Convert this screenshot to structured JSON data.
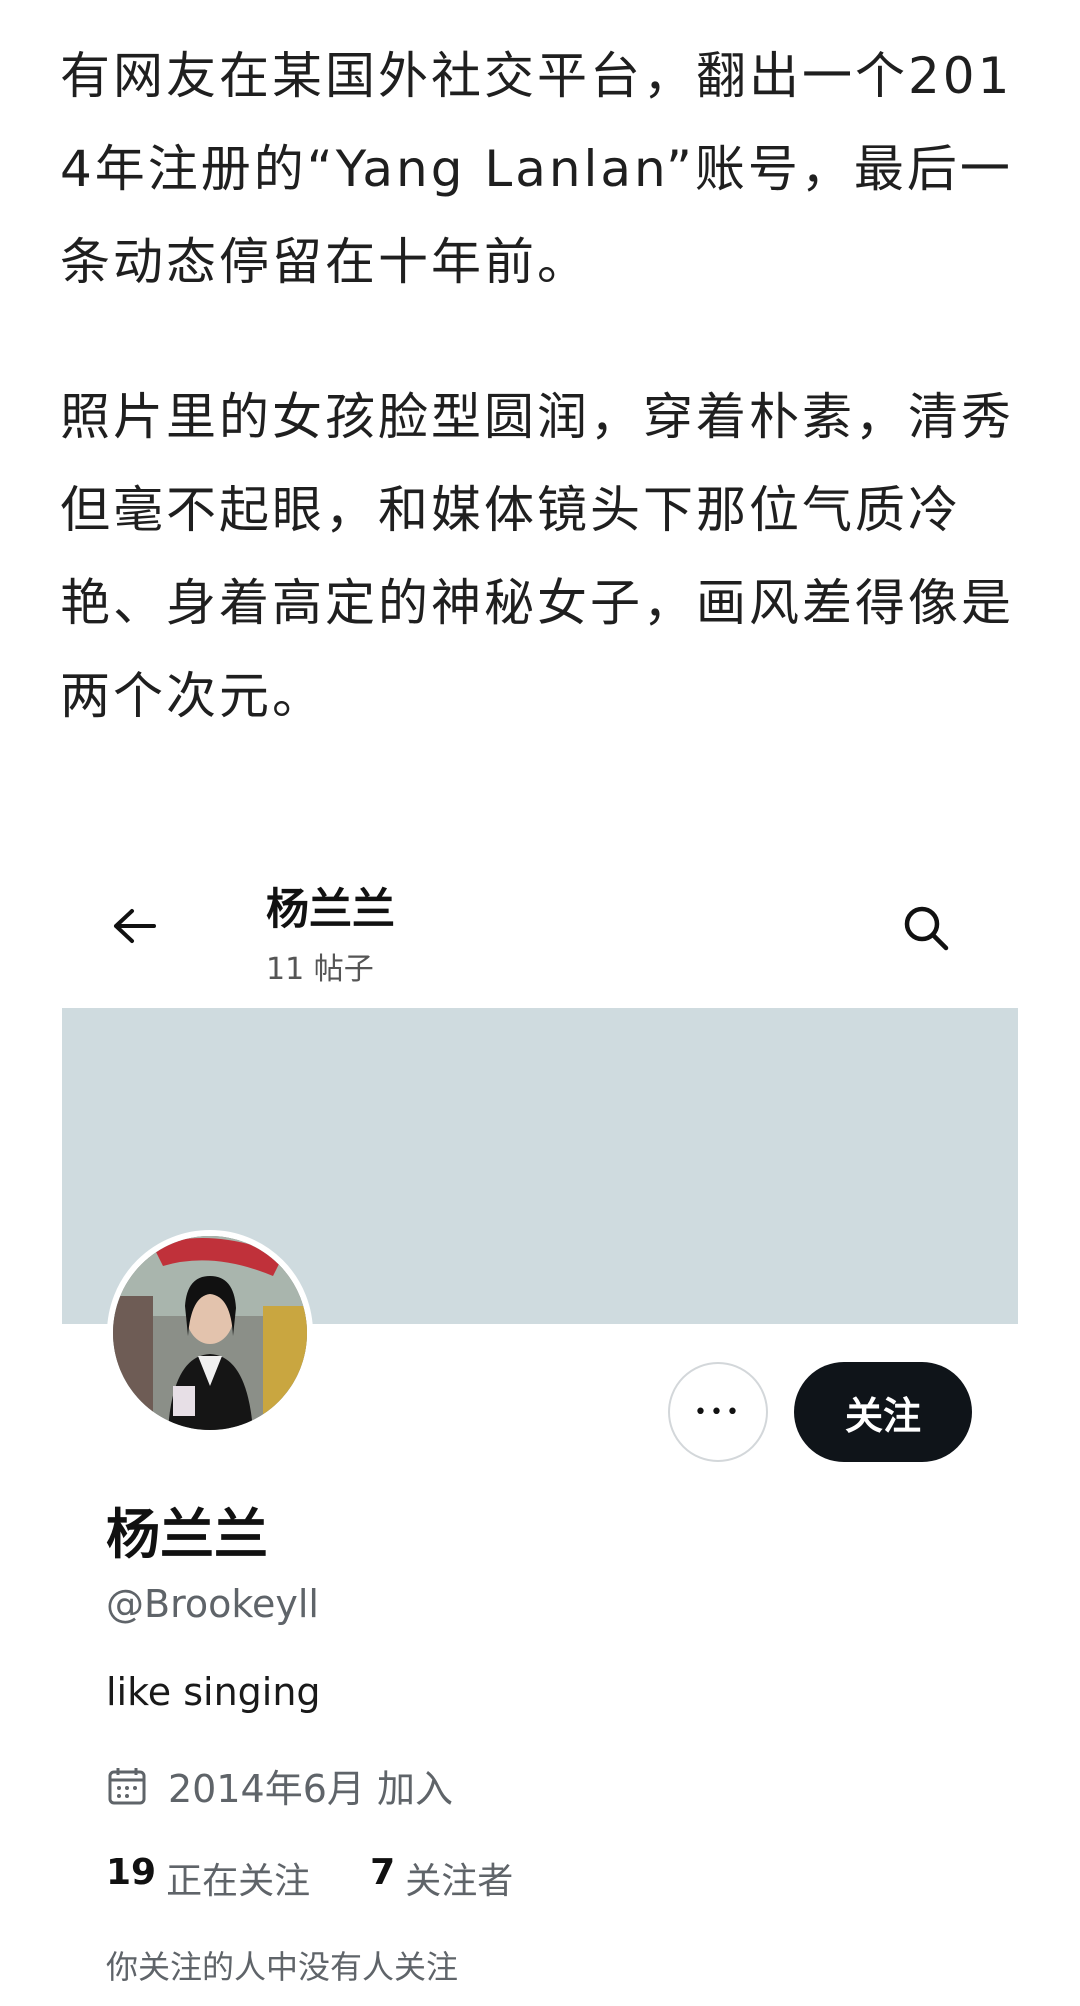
{
  "article": {
    "paragraphs": [
      "有网友在某国外社交平台，翻出一个2014年注册的“Yang Lanlan”账号，最后一条动态停留在十年前。",
      "照片里的女孩脸型圆润，穿着朴素，清秀但毫不起眼，和媒体镜头下那位气质冷艳、身着高定的神秘女子，画风差得像是两个次元。"
    ]
  },
  "profile": {
    "topbar": {
      "name": "杨兰兰",
      "posts": "11 帖子",
      "back_icon": "back-arrow-icon",
      "search_icon": "search-icon"
    },
    "banner_color": "#cfdbdf",
    "more_label": "•••",
    "follow_label": "关注",
    "display_name": "杨兰兰",
    "handle": "@Brookeyll",
    "bio": "like singing",
    "joined": "2014年6月 加入",
    "following_count": "19",
    "following_label": "正在关注",
    "followers_count": "7",
    "followers_label": "关注者",
    "mutual_note": "你关注的人中没有人关注"
  }
}
